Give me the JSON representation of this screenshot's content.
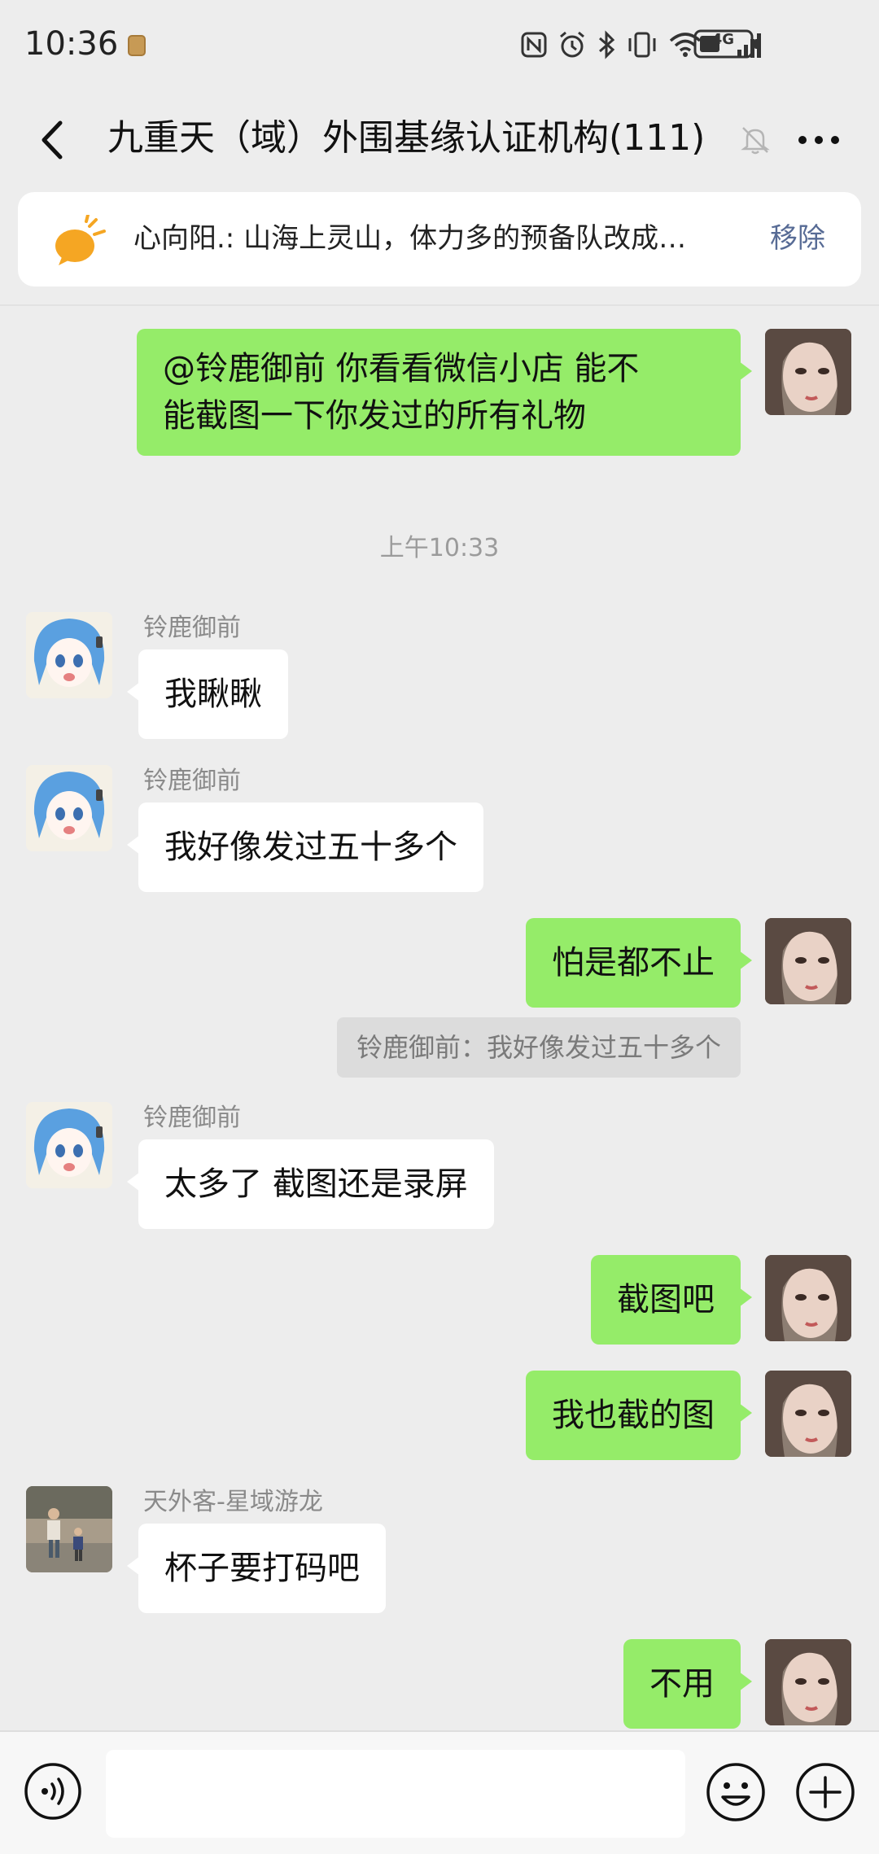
{
  "status_bar": {
    "time": "10:36",
    "network": "4G",
    "icons": [
      "nfc-icon",
      "alarm-icon",
      "bluetooth-icon",
      "vibrate-icon",
      "wifi-icon",
      "signal-icon",
      "battery-icon"
    ]
  },
  "header": {
    "title": "九重天（域）外围基缘认证机构(111)",
    "back_icon": "back-arrow-icon",
    "mute_icon": "bell-muted-icon",
    "more_icon": "more-dots-icon"
  },
  "pinned": {
    "text": "心向阳.:  山海上灵山，体力多的预备队改成…",
    "remove_label": "移除"
  },
  "messages": {
    "m1": {
      "text_line1": "@铃鹿御前  你看看微信小店 能不",
      "text_line2": "能截图一下你发过的所有礼物"
    },
    "ts1": "上午10:33",
    "m2": {
      "sender": "铃鹿御前",
      "text": "我瞅瞅"
    },
    "m3": {
      "sender": "铃鹿御前",
      "text": "我好像发过五十多个"
    },
    "m4": {
      "text": "怕是都不止"
    },
    "m4_quote": "铃鹿御前：我好像发过五十多个",
    "m5": {
      "sender": "铃鹿御前",
      "text": "太多了 截图还是录屏"
    },
    "m6": {
      "text": "截图吧"
    },
    "m7": {
      "text": "我也截的图"
    },
    "m8": {
      "sender": "天外客-星域游龙",
      "text": "杯子要打码吧"
    },
    "m9": {
      "text": "不用"
    }
  },
  "input_bar": {
    "value": "",
    "voice_icon": "voice-icon",
    "emoji_icon": "emoji-icon",
    "plus_icon": "plus-icon"
  },
  "colors": {
    "background": "#ededed",
    "my_bubble": "#95ec69",
    "other_bubble": "#ffffff",
    "link": "#576b95"
  }
}
